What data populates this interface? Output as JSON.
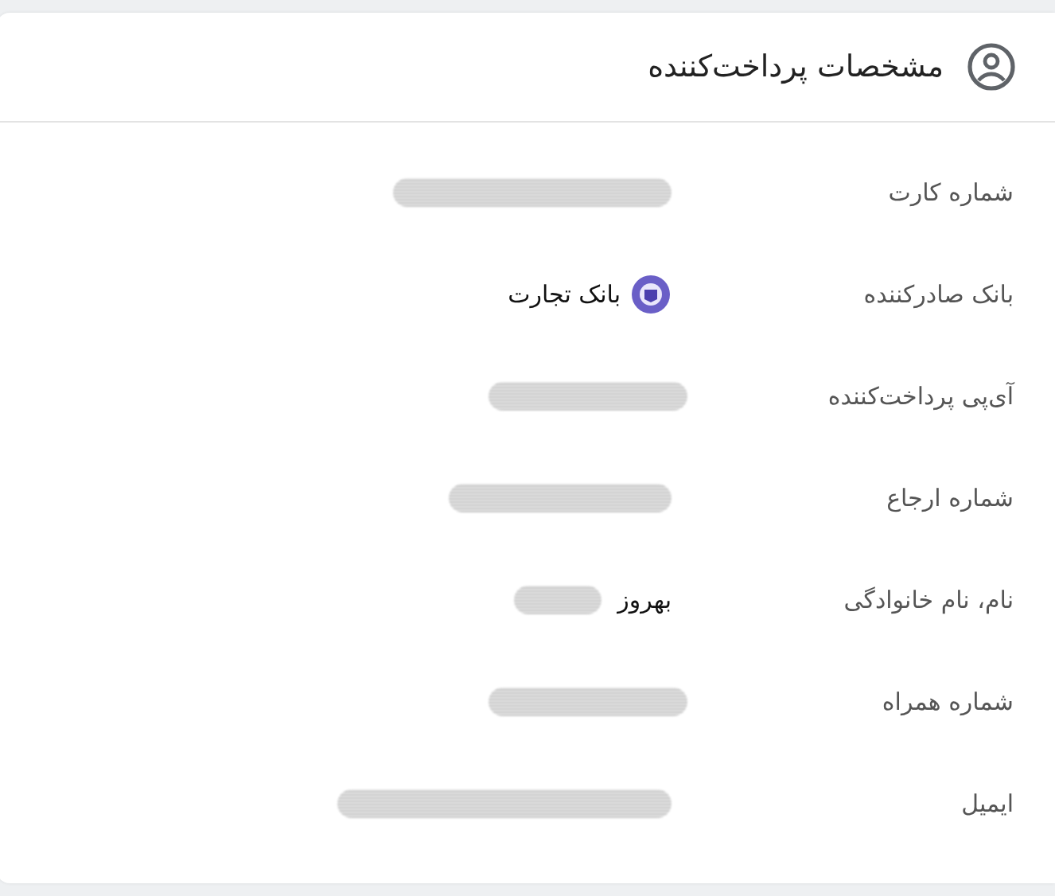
{
  "card": {
    "title": "مشخصات پرداخت‌کننده"
  },
  "rows": [
    {
      "label": "شماره کارت",
      "parts": [
        {
          "kind": "redacted"
        }
      ]
    },
    {
      "label": "بانک صادرکننده",
      "parts": [
        {
          "kind": "bank",
          "text": "بانک تجارت"
        }
      ]
    },
    {
      "label": "آی‌پی پرداخت‌کننده",
      "parts": [
        {
          "kind": "redacted"
        }
      ]
    },
    {
      "label": "شماره ارجاع",
      "parts": [
        {
          "kind": "redacted"
        }
      ]
    },
    {
      "label": "نام، نام خانوادگی",
      "parts": [
        {
          "kind": "text",
          "text": "بهروز"
        },
        {
          "kind": "redacted"
        }
      ]
    },
    {
      "label": "شماره همراه",
      "parts": [
        {
          "kind": "redacted"
        }
      ]
    },
    {
      "label": "ایمیل",
      "parts": [
        {
          "kind": "redacted"
        }
      ]
    }
  ]
}
